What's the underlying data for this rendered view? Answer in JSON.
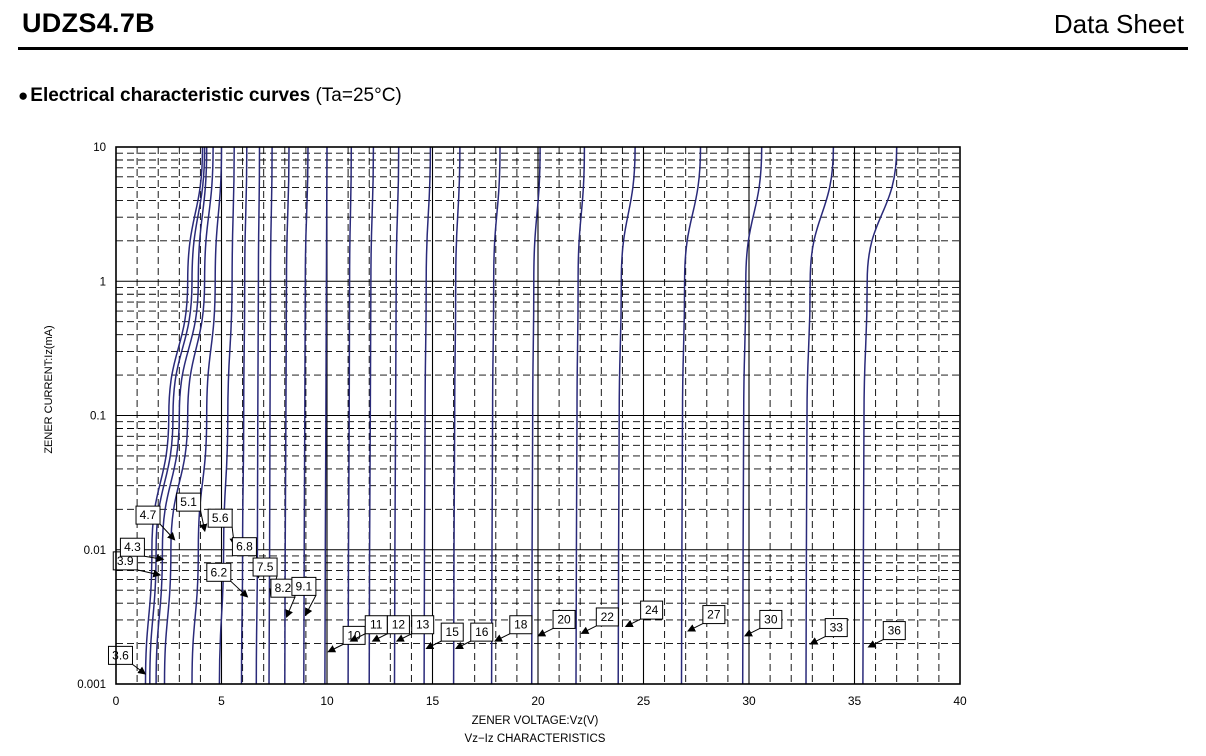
{
  "header": {
    "part_number": "UDZS4.7B",
    "doc_type": "Data Sheet"
  },
  "section": {
    "bullet": "●",
    "title": "Electrical characteristic curves",
    "condition": "(Ta=25°C)"
  },
  "colors": {
    "curve": "#2a2a7a",
    "grid": "#000000"
  },
  "chart_data": {
    "type": "line",
    "title": "Vz−Iz CHARACTERISTICS",
    "xlabel": "ZENER VOLTAGE:Vz(V)",
    "ylabel": "ZENER CURRENT:Iz(mA)",
    "xlim": [
      0,
      40
    ],
    "ylim": [
      0.001,
      10
    ],
    "yscale": "log",
    "grid": true,
    "x_ticks": [
      0,
      5,
      10,
      15,
      20,
      25,
      30,
      35,
      40
    ],
    "y_ticks": [
      "10",
      "1",
      "0.1",
      "0.01",
      "0.001"
    ],
    "series": [
      {
        "name": "3.6",
        "points": [
          [
            1.4,
            0.001
          ],
          [
            1.7,
            0.01
          ],
          [
            2.5,
            0.1
          ],
          [
            3.4,
            1
          ],
          [
            4.1,
            10
          ]
        ]
      },
      {
        "name": "3.9",
        "points": [
          [
            1.6,
            0.001
          ],
          [
            1.9,
            0.01
          ],
          [
            2.7,
            0.1
          ],
          [
            3.6,
            1
          ],
          [
            4.2,
            10
          ]
        ]
      },
      {
        "name": "4.3",
        "points": [
          [
            1.9,
            0.001
          ],
          [
            2.2,
            0.01
          ],
          [
            3.0,
            0.1
          ],
          [
            3.9,
            1
          ],
          [
            4.3,
            10
          ]
        ]
      },
      {
        "name": "4.7",
        "points": [
          [
            2.3,
            0.001
          ],
          [
            2.6,
            0.01
          ],
          [
            3.4,
            0.1
          ],
          [
            4.2,
            1
          ],
          [
            4.6,
            10
          ]
        ]
      },
      {
        "name": "5.1",
        "points": [
          [
            3.6,
            0.001
          ],
          [
            3.9,
            0.01
          ],
          [
            4.3,
            0.1
          ],
          [
            4.7,
            1
          ],
          [
            5.0,
            10
          ]
        ]
      },
      {
        "name": "5.6",
        "points": [
          [
            4.9,
            0.001
          ],
          [
            5.1,
            0.01
          ],
          [
            5.3,
            0.1
          ],
          [
            5.5,
            1
          ],
          [
            5.6,
            10
          ]
        ]
      },
      {
        "name": "6.2",
        "points": [
          [
            5.95,
            0.001
          ],
          [
            6.0,
            0.01
          ],
          [
            6.05,
            0.1
          ],
          [
            6.1,
            1
          ],
          [
            6.2,
            10
          ]
        ]
      },
      {
        "name": "6.8",
        "points": [
          [
            6.65,
            0.001
          ],
          [
            6.7,
            0.01
          ],
          [
            6.72,
            0.1
          ],
          [
            6.75,
            1
          ],
          [
            6.8,
            10
          ]
        ]
      },
      {
        "name": "7.5",
        "points": [
          [
            7.25,
            0.001
          ],
          [
            7.28,
            0.01
          ],
          [
            7.3,
            0.1
          ],
          [
            7.32,
            1
          ],
          [
            7.4,
            10
          ]
        ]
      },
      {
        "name": "8.2",
        "points": [
          [
            8.0,
            0.001
          ],
          [
            8.02,
            0.01
          ],
          [
            8.05,
            0.1
          ],
          [
            8.08,
            1
          ],
          [
            8.2,
            10
          ]
        ]
      },
      {
        "name": "9.1",
        "points": [
          [
            8.9,
            0.001
          ],
          [
            8.92,
            0.01
          ],
          [
            8.95,
            0.1
          ],
          [
            8.97,
            1
          ],
          [
            9.1,
            10
          ]
        ]
      },
      {
        "name": "10",
        "points": [
          [
            9.9,
            0.001
          ],
          [
            9.92,
            0.01
          ],
          [
            9.95,
            0.1
          ],
          [
            9.97,
            1
          ],
          [
            10.0,
            10
          ]
        ]
      },
      {
        "name": "11",
        "points": [
          [
            11.0,
            0.001
          ],
          [
            11.02,
            0.01
          ],
          [
            11.05,
            0.1
          ],
          [
            11.07,
            1
          ],
          [
            11.15,
            10
          ]
        ]
      },
      {
        "name": "12",
        "points": [
          [
            12.0,
            0.001
          ],
          [
            12.02,
            0.01
          ],
          [
            12.05,
            0.1
          ],
          [
            12.08,
            1
          ],
          [
            12.2,
            10
          ]
        ]
      },
      {
        "name": "13",
        "points": [
          [
            13.2,
            0.001
          ],
          [
            13.22,
            0.01
          ],
          [
            13.25,
            0.1
          ],
          [
            13.28,
            1
          ],
          [
            13.4,
            10
          ]
        ]
      },
      {
        "name": "15",
        "points": [
          [
            14.6,
            0.001
          ],
          [
            14.62,
            0.01
          ],
          [
            14.65,
            0.1
          ],
          [
            14.7,
            1
          ],
          [
            14.9,
            10
          ]
        ]
      },
      {
        "name": "16",
        "points": [
          [
            16.0,
            0.001
          ],
          [
            16.02,
            0.01
          ],
          [
            16.05,
            0.1
          ],
          [
            16.1,
            1
          ],
          [
            16.3,
            10
          ]
        ]
      },
      {
        "name": "18",
        "points": [
          [
            17.8,
            0.001
          ],
          [
            17.82,
            0.01
          ],
          [
            17.85,
            0.1
          ],
          [
            17.9,
            1
          ],
          [
            18.2,
            10
          ]
        ]
      },
      {
        "name": "20",
        "points": [
          [
            19.7,
            0.001
          ],
          [
            19.72,
            0.01
          ],
          [
            19.75,
            0.1
          ],
          [
            19.8,
            1
          ],
          [
            20.1,
            10
          ]
        ]
      },
      {
        "name": "22",
        "points": [
          [
            21.8,
            0.001
          ],
          [
            21.82,
            0.01
          ],
          [
            21.85,
            0.1
          ],
          [
            21.9,
            1
          ],
          [
            22.2,
            10
          ]
        ]
      },
      {
        "name": "24",
        "points": [
          [
            23.8,
            0.001
          ],
          [
            23.82,
            0.01
          ],
          [
            23.85,
            0.1
          ],
          [
            23.95,
            1
          ],
          [
            24.6,
            10
          ]
        ]
      },
      {
        "name": "27",
        "points": [
          [
            26.8,
            0.001
          ],
          [
            26.82,
            0.01
          ],
          [
            26.85,
            0.1
          ],
          [
            26.95,
            1
          ],
          [
            27.7,
            10
          ]
        ]
      },
      {
        "name": "30",
        "points": [
          [
            29.7,
            0.001
          ],
          [
            29.72,
            0.01
          ],
          [
            29.75,
            0.1
          ],
          [
            29.85,
            1
          ],
          [
            30.6,
            10
          ]
        ]
      },
      {
        "name": "33",
        "points": [
          [
            32.7,
            0.001
          ],
          [
            32.72,
            0.01
          ],
          [
            32.75,
            0.1
          ],
          [
            32.9,
            1
          ],
          [
            34.0,
            10
          ]
        ]
      },
      {
        "name": "36",
        "points": [
          [
            35.4,
            0.001
          ],
          [
            35.42,
            0.01
          ],
          [
            35.45,
            0.1
          ],
          [
            35.6,
            1
          ],
          [
            37.0,
            10
          ]
        ]
      }
    ],
    "labels": [
      {
        "text": "3.6",
        "anchor": [
          1.35,
          0.0012
        ]
      },
      {
        "text": "3.9",
        "anchor": [
          2.05,
          0.0065
        ]
      },
      {
        "text": "4.3",
        "anchor": [
          2.2,
          0.0085
        ]
      },
      {
        "text": "4.7",
        "anchor": [
          2.75,
          0.012
        ]
      },
      {
        "text": "5.1",
        "anchor": [
          4.2,
          0.014
        ]
      },
      {
        "text": "5.6",
        "anchor": [
          5.6,
          0.011
        ]
      },
      {
        "text": "6.2",
        "anchor": [
          6.2,
          0.0045
        ]
      },
      {
        "text": "6.8",
        "anchor": [
          6.75,
          0.0063
        ]
      },
      {
        "text": "7.5",
        "anchor": [
          7.35,
          0.0046
        ]
      },
      {
        "text": "8.2",
        "anchor": [
          8.1,
          0.0032
        ]
      },
      {
        "text": "9.1",
        "anchor": [
          9.0,
          0.0033
        ]
      },
      {
        "text": "10",
        "anchor": [
          10.1,
          0.00175
        ]
      },
      {
        "text": "11",
        "anchor": [
          11.15,
          0.0021
        ]
      },
      {
        "text": "12",
        "anchor": [
          12.2,
          0.0021
        ]
      },
      {
        "text": "13",
        "anchor": [
          13.35,
          0.0021
        ]
      },
      {
        "text": "15",
        "anchor": [
          14.75,
          0.00185
        ]
      },
      {
        "text": "16",
        "anchor": [
          16.15,
          0.00185
        ]
      },
      {
        "text": "18",
        "anchor": [
          18.0,
          0.0021
        ]
      },
      {
        "text": "20",
        "anchor": [
          20.05,
          0.0023
        ]
      },
      {
        "text": "22",
        "anchor": [
          22.1,
          0.0024
        ]
      },
      {
        "text": "24",
        "anchor": [
          24.2,
          0.0027
        ]
      },
      {
        "text": "27",
        "anchor": [
          27.15,
          0.0025
        ]
      },
      {
        "text": "30",
        "anchor": [
          29.85,
          0.0023
        ]
      },
      {
        "text": "33",
        "anchor": [
          32.95,
          0.002
        ]
      },
      {
        "text": "36",
        "anchor": [
          35.7,
          0.0019
        ]
      }
    ]
  }
}
